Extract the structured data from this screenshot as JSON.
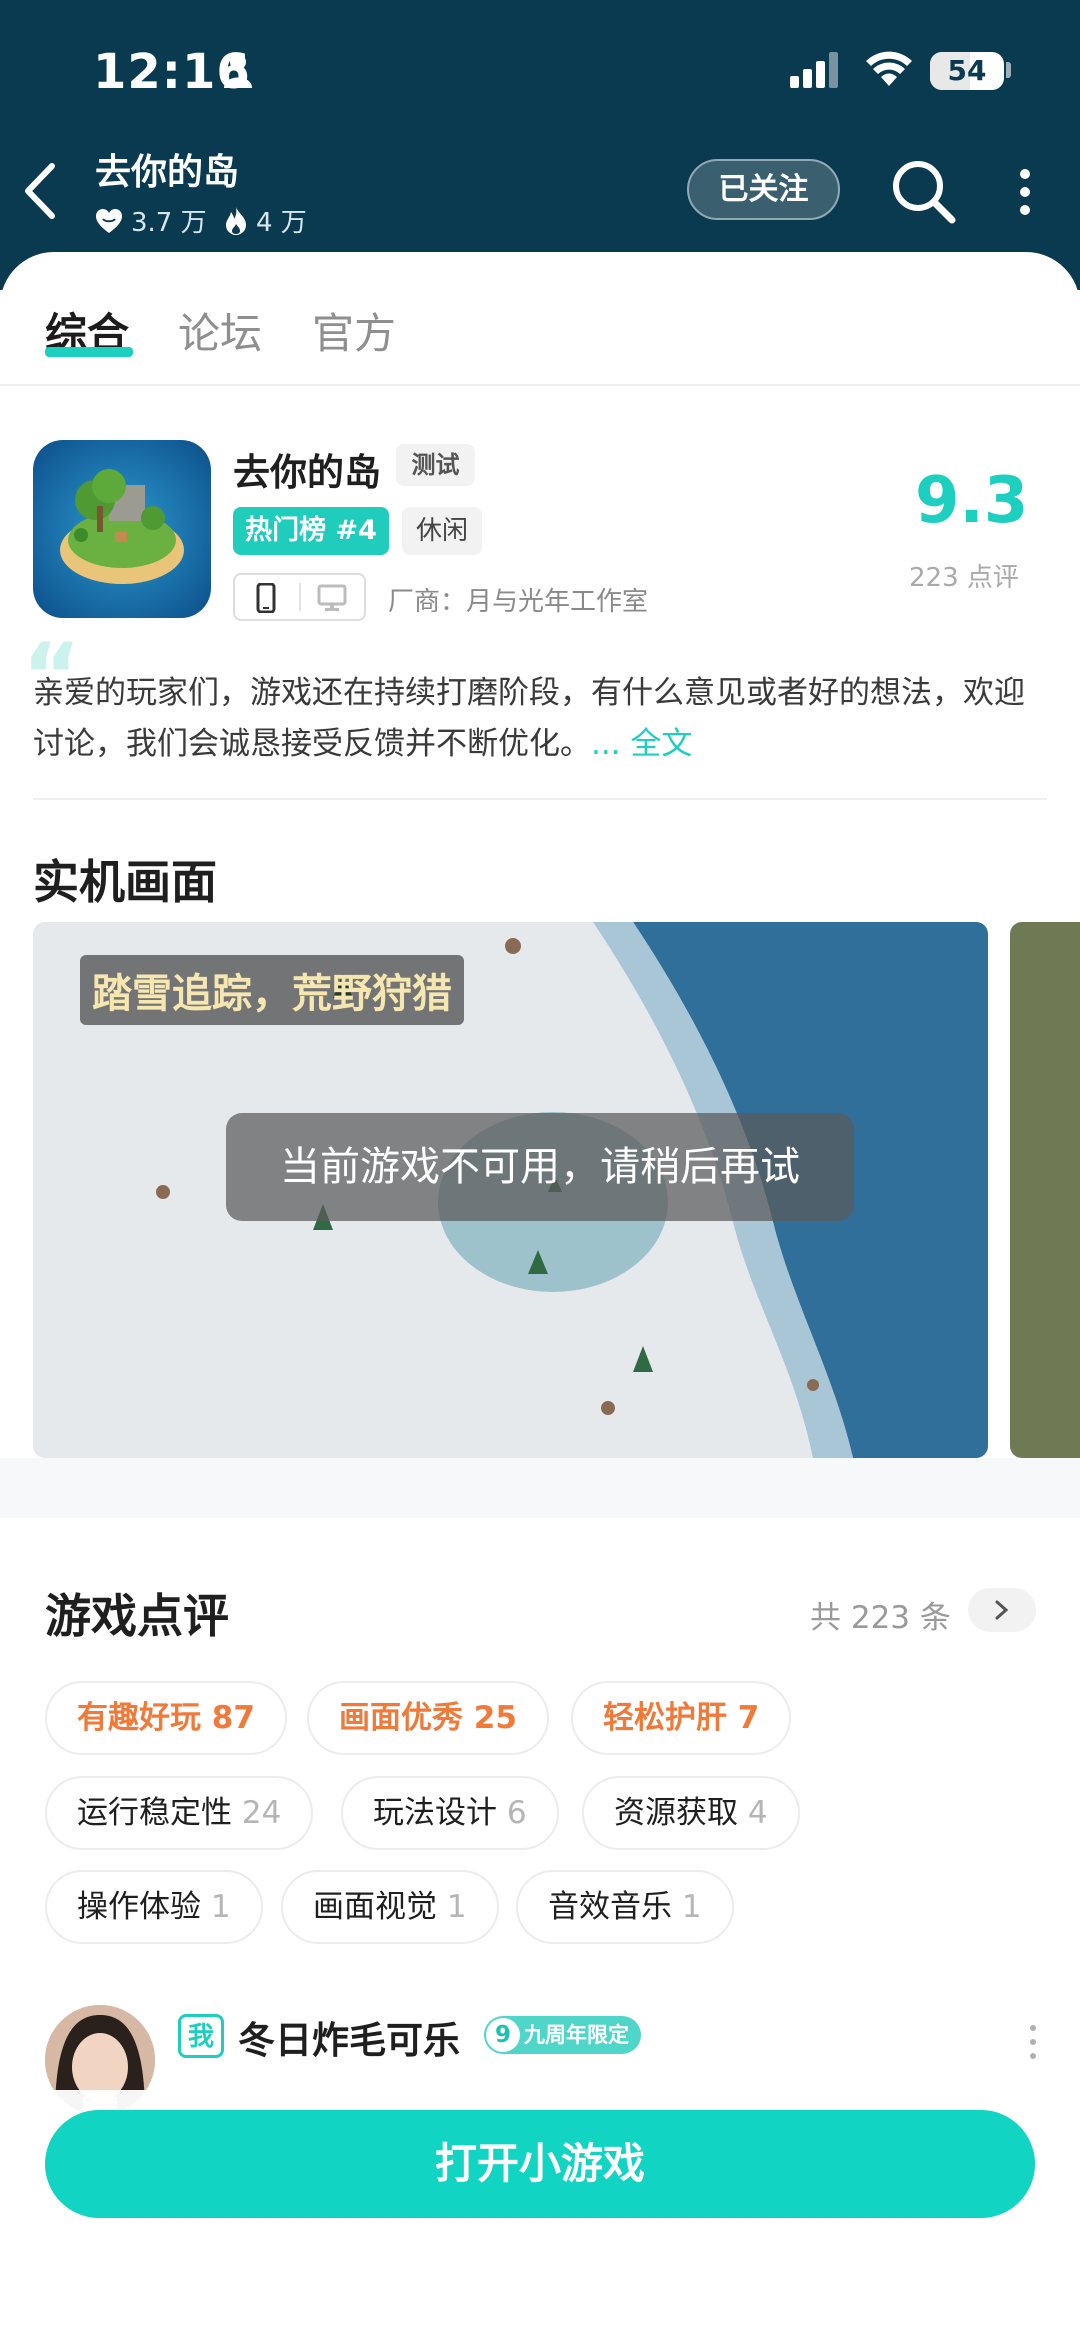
{
  "status_bar": {
    "time": "12:16",
    "battery": "54"
  },
  "header": {
    "title": "去你的岛",
    "likes": "3.7 万",
    "hot": "4 万",
    "follow_label": "已关注"
  },
  "tabs": [
    "综合",
    "论坛",
    "官方"
  ],
  "game": {
    "name": "去你的岛",
    "test_tag": "测试",
    "hot_rank": "热门榜 #4",
    "genre": "休闲",
    "vendor": "厂商：月与光年工作室",
    "score": "9.3",
    "score_count": "223 点评",
    "description": "亲爱的玩家们，游戏还在持续打磨阶段，有什么意见或者好的想法，欢迎讨论，我们会诚恳接受反馈并不断优化。",
    "full_text": "... 全文"
  },
  "screens": {
    "title": "实机画面",
    "caption": "踏雪追踪，荒野狩猎",
    "toast": "当前游戏不可用，请稍后再试"
  },
  "reviews": {
    "title": "游戏点评",
    "count": "共 223 条",
    "tags": [
      {
        "label": "有趣好玩",
        "count": "87"
      },
      {
        "label": "画面优秀",
        "count": "25"
      },
      {
        "label": "轻松护肝",
        "count": "7"
      },
      {
        "label": "运行稳定性",
        "count": "24"
      },
      {
        "label": "玩法设计",
        "count": "6"
      },
      {
        "label": "资源获取",
        "count": "4"
      },
      {
        "label": "操作体验",
        "count": "1"
      },
      {
        "label": "画面视觉",
        "count": "1"
      },
      {
        "label": "音效音乐",
        "count": "1"
      }
    ],
    "first": {
      "me_tag": "我",
      "user": "冬日炸毛可乐",
      "badge_num": "9",
      "badge": "九周年限定"
    }
  },
  "bottom": {
    "open_label": "打开小游戏"
  },
  "colors": {
    "accent": "#1ccfbf",
    "header_bg": "#0a3a50",
    "hot_tag": "#f07a3a"
  }
}
